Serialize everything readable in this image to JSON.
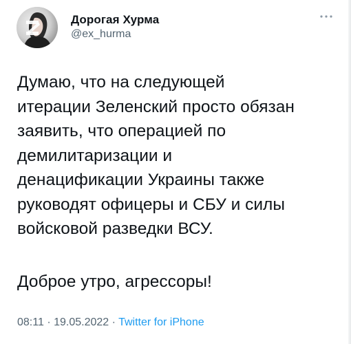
{
  "author": {
    "display_name": "Дорогая Хурма",
    "handle": "@ex_hurma",
    "avatar_icon": "user-avatar-photo"
  },
  "tweet": {
    "lines": [
      "Думаю, что на следующей",
      "итерации Зеленский просто обязан",
      "заявить, что операцией по",
      "демилитаризации и",
      "денацификации Украины также",
      "руководят офицеры и СБУ и силы",
      "войсковой разведки ВСУ."
    ],
    "greeting": "Доброе утро, агрессоры!"
  },
  "meta": {
    "time": "08:11",
    "separator": "·",
    "date": "19.05.2022",
    "source": "Twitter for iPhone"
  },
  "colors": {
    "text": "#0f1419",
    "secondary": "#536471",
    "accent": "#1d9bf0"
  },
  "icons": {
    "more": "more-dots-icon"
  }
}
